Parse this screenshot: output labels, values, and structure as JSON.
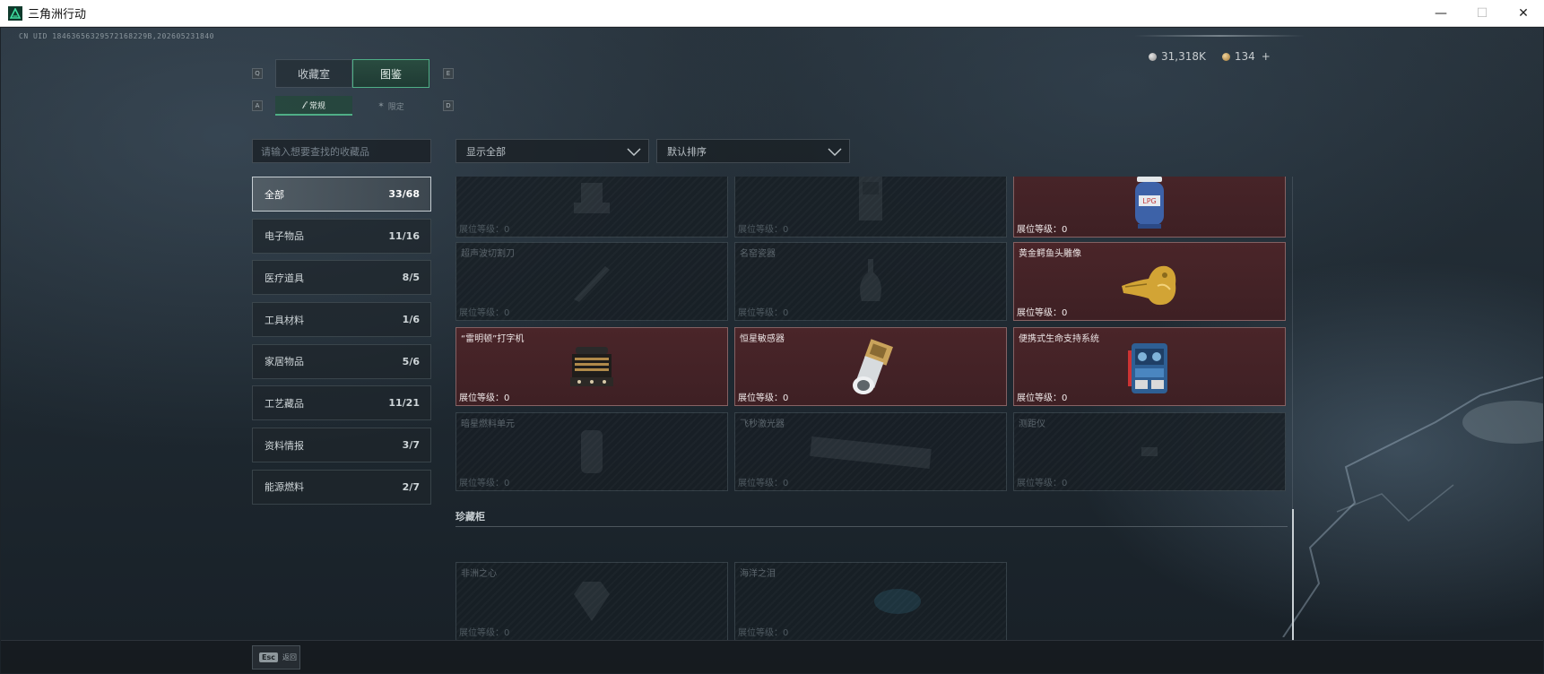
{
  "window": {
    "title": "三角洲行动",
    "minimize": "—",
    "maximize": "☐",
    "close": "✕"
  },
  "uid": "CN UID 18463656329572168229B,202605231840",
  "currency": {
    "silver": "31,318K",
    "gold": "134",
    "plus": "+"
  },
  "keys": {
    "tab_prev": "Q",
    "tab_next": "E",
    "sub_prev": "A",
    "sub_next": "D"
  },
  "main_tabs": [
    {
      "label": "收藏室",
      "active": false
    },
    {
      "label": "图鉴",
      "active": true
    }
  ],
  "sub_tabs": [
    {
      "label": "常规",
      "active": true
    },
    {
      "label": "限定",
      "active": false
    }
  ],
  "search": {
    "placeholder": "请输入想要查找的收藏品"
  },
  "categories": [
    {
      "label": "全部",
      "count": "33/68",
      "active": true
    },
    {
      "label": "电子物品",
      "count": "11/16"
    },
    {
      "label": "医疗道具",
      "count": "8/5"
    },
    {
      "label": "工具材料",
      "count": "1/6"
    },
    {
      "label": "家居物品",
      "count": "5/6"
    },
    {
      "label": "工艺藏品",
      "count": "11/21"
    },
    {
      "label": "资料情报",
      "count": "3/7"
    },
    {
      "label": "能源燃料",
      "count": "2/7"
    }
  ],
  "filters": {
    "show": "显示全部",
    "sort": "默认排序"
  },
  "cards": [
    {
      "name": "",
      "level": "展位等级：0",
      "owned": false,
      "icon": "robot-icon"
    },
    {
      "name": "",
      "level": "展位等级：0",
      "owned": false,
      "icon": "cabinet-icon"
    },
    {
      "name": "",
      "level": "展位等级：0",
      "owned": true,
      "icon": "gas-tank-icon"
    },
    {
      "name": "超声波切割刀",
      "level": "展位等级：0",
      "owned": false,
      "icon": "knife-icon"
    },
    {
      "name": "名窑瓷器",
      "level": "展位等级：0",
      "owned": false,
      "icon": "vase-icon"
    },
    {
      "name": "黄金鳄鱼头雕像",
      "level": "展位等级：0",
      "owned": true,
      "icon": "gold-crocodile-icon"
    },
    {
      "name": "“雷明顿”打字机",
      "level": "展位等级：0",
      "owned": true,
      "icon": "typewriter-icon"
    },
    {
      "name": "恒星敏感器",
      "level": "展位等级：0",
      "owned": true,
      "icon": "star-sensor-icon"
    },
    {
      "name": "便携式生命支持系统",
      "level": "展位等级：0",
      "owned": true,
      "icon": "life-support-icon"
    },
    {
      "name": "暗星燃料单元",
      "level": "展位等级：0",
      "owned": false,
      "icon": "fuel-cell-icon"
    },
    {
      "name": "飞秒激光器",
      "level": "展位等级：0",
      "owned": false,
      "icon": "laser-icon"
    },
    {
      "name": "测距仪",
      "level": "展位等级：0",
      "owned": false,
      "icon": "rangefinder-icon"
    }
  ],
  "section": {
    "title": "珍藏柜",
    "cards": [
      {
        "name": "非洲之心",
        "level": "展位等级：0",
        "owned": false,
        "icon": "diamond-icon"
      },
      {
        "name": "海洋之泪",
        "level": "展位等级：0",
        "owned": false,
        "icon": "gem-icon"
      }
    ]
  },
  "footer": {
    "esc_key": "Esc",
    "esc_label": "返回"
  },
  "colors": {
    "accent_green": "#4fae86",
    "owned_card": "#4a2529",
    "background": "#1c2329"
  }
}
